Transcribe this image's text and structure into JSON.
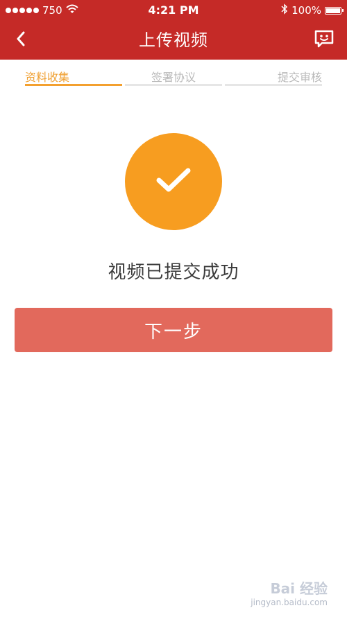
{
  "status_bar": {
    "carrier": "750",
    "time": "4:21 PM",
    "battery": "100%"
  },
  "nav": {
    "title": "上传视频"
  },
  "steps": [
    {
      "label": "资料收集",
      "active": true
    },
    {
      "label": "签署协议",
      "active": false
    },
    {
      "label": "提交审核",
      "active": false
    }
  ],
  "success": {
    "message": "视频已提交成功"
  },
  "actions": {
    "next_label": "下一步"
  },
  "watermark": {
    "brand": "Bai 经验",
    "url": "jingyan.baidu.com"
  },
  "colors": {
    "header": "#c52a27",
    "accent": "#f79d20",
    "button": "#e2695c"
  }
}
